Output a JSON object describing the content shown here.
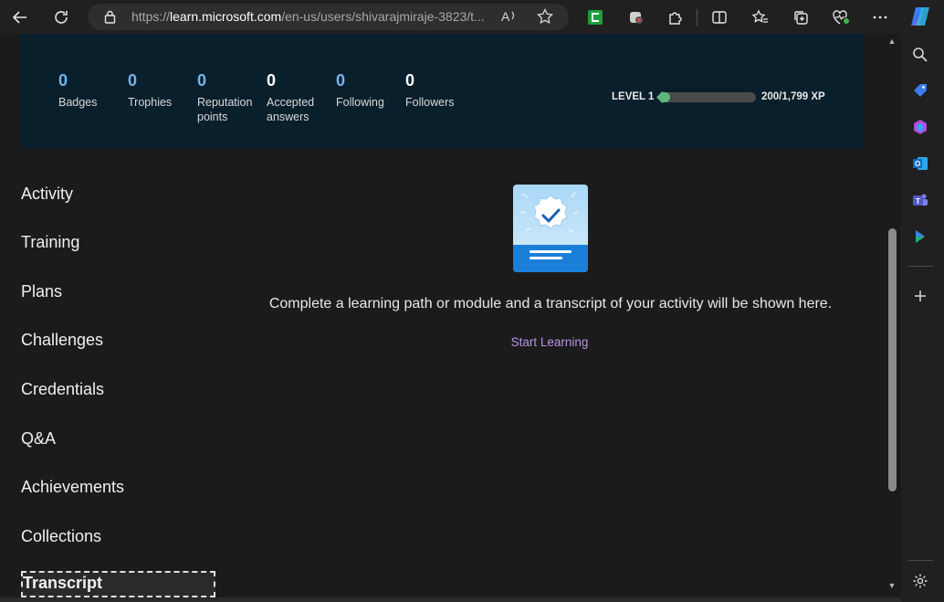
{
  "browser": {
    "url_prefix": "https://",
    "url_host": "learn.microsoft.com",
    "url_rest": "/en-us/users/shivarajmiraje-3823/t..."
  },
  "profile": {
    "stats": [
      {
        "value": "0",
        "label": "Badges"
      },
      {
        "value": "0",
        "label": "Trophies"
      },
      {
        "value": "0",
        "label": "Reputation points"
      },
      {
        "value": "0",
        "label": "Accepted answers"
      },
      {
        "value": "0",
        "label": "Following"
      },
      {
        "value": "0",
        "label": "Followers"
      }
    ],
    "level_label": "LEVEL 1",
    "xp_text": "200/1,799 XP",
    "xp_fraction": 0.11
  },
  "nav": {
    "items": [
      "Activity",
      "Training",
      "Plans",
      "Challenges",
      "Credentials",
      "Q&A",
      "Achievements",
      "Collections",
      "Transcript"
    ],
    "active": "Transcript"
  },
  "main": {
    "empty_message": "Complete a learning path or module and a transcript of your activity will be shown here.",
    "start_link": "Start Learning"
  },
  "colors": {
    "accent_blue": "#75b6e7",
    "link_purple": "#b793e8",
    "xp_green": "#5fb87a",
    "header_bg": "#0a1f2c"
  }
}
